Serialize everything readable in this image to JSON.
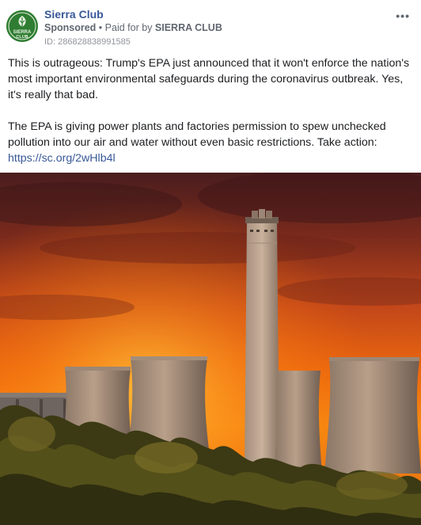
{
  "post": {
    "page_name": "Sierra Club",
    "sponsored_label": "Sponsored",
    "separator": "•",
    "paid_for_prefix": "Paid for by",
    "paid_for_by": "SIERRA CLUB",
    "ad_id": "ID: 286828838991585",
    "more_icon": "more-options-icon",
    "paragraph_1": "This is outrageous: Trump's EPA just announced that it won't enforce the nation's most important environmental safeguards during the coronavirus outbreak. Yes, it's really that bad.",
    "paragraph_2": "The EPA is giving power plants and factories permission to spew unchecked pollution into our air and water without even basic restrictions. Take action:",
    "link": "https://sc.org/2wHlb4l"
  },
  "avatar": {
    "logo_text_1": "SIERRA",
    "logo_text_2": "CLUB",
    "color": "#2f7d32"
  },
  "colors": {
    "link": "#385898",
    "meta": "#606770",
    "body_text": "#1c1e21"
  }
}
